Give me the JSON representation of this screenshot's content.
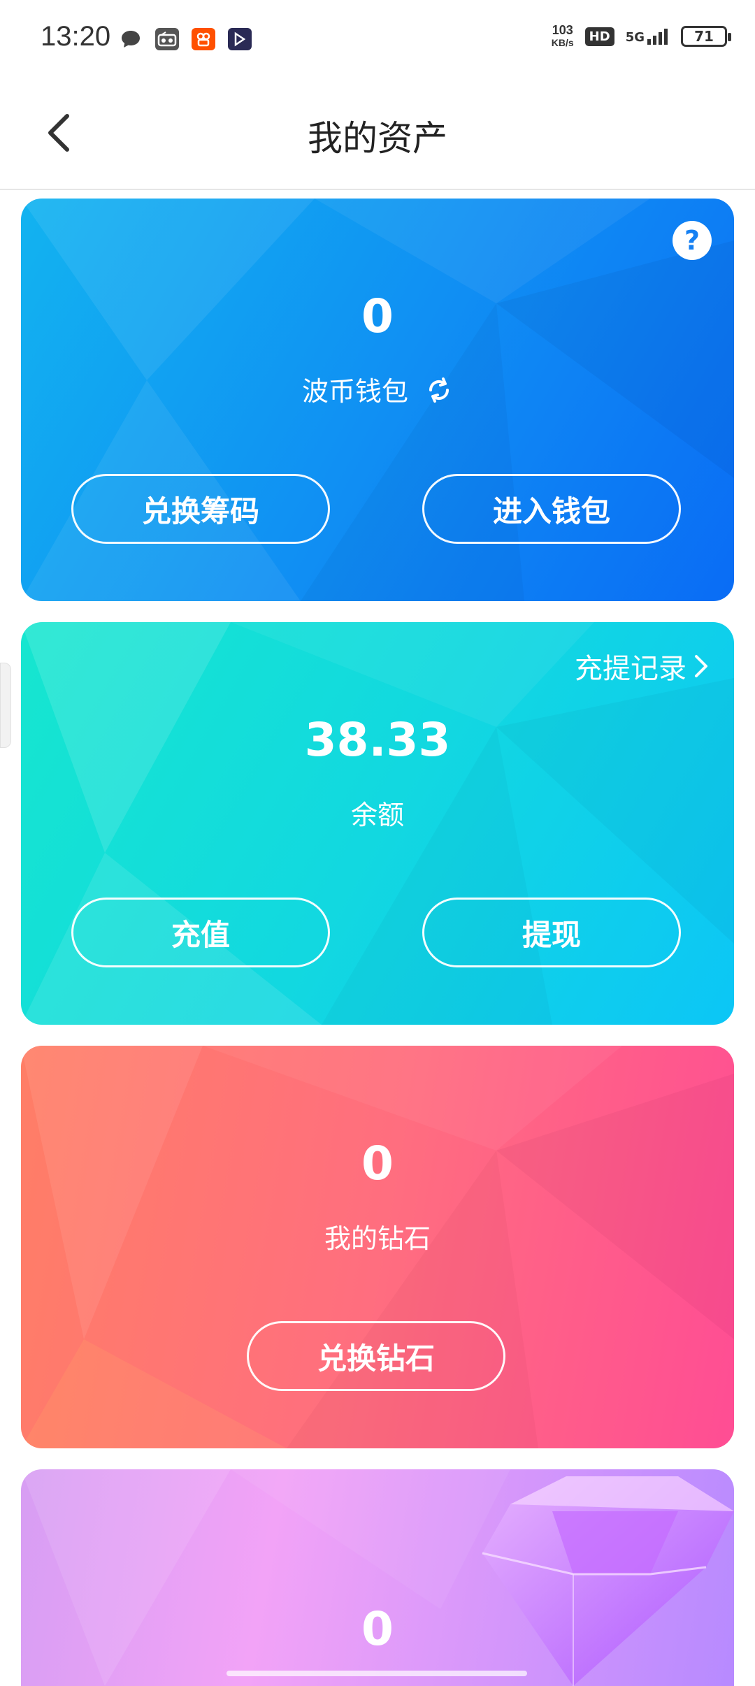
{
  "status_bar": {
    "time": "13:20",
    "speed_value": "103",
    "speed_unit": "KB/s",
    "hd": "HD",
    "network": "5G",
    "battery": "71"
  },
  "header": {
    "title": "我的资产"
  },
  "wallet_card": {
    "amount": "0",
    "label": "波币钱包",
    "btn_exchange": "兑换筹码",
    "btn_enter": "进入钱包",
    "help": "?"
  },
  "balance_card": {
    "records_link": "充提记录",
    "amount": "38.33",
    "label": "余额",
    "btn_recharge": "充值",
    "btn_withdraw": "提现"
  },
  "diamond_card": {
    "amount": "0",
    "label": "我的钻石",
    "btn_exchange": "兑换钻石"
  },
  "fourth_card": {
    "amount": "0"
  },
  "colors": {
    "blue_card": "#1090f3",
    "cyan_card": "#12d8e0",
    "red_card": "#ff6e7f",
    "purple_card": "#d79ef3"
  }
}
